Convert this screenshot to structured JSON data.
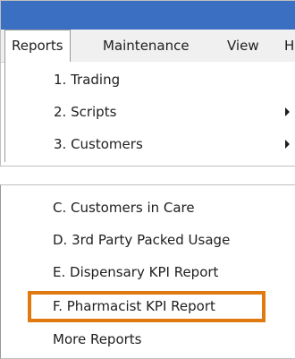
{
  "menu_bar": {
    "items": [
      "Reports",
      "Maintenance",
      "View",
      "H"
    ]
  },
  "reports_menu": {
    "items": [
      "1. Trading",
      "2. Scripts",
      "3. Customers"
    ]
  },
  "reports_submenu": {
    "items": [
      "C. Customers in Care",
      "D. 3rd Party Packed Usage",
      "E. Dispensary KPI Report",
      "F. Pharmacist KPI Report",
      "More Reports"
    ],
    "highlighted_item": "F. Pharmacist KPI Report",
    "highlight_color": "#e07a10"
  },
  "colors": {
    "title_bar": "#3b6fc1",
    "menu_bar": "#f0f0f0"
  }
}
